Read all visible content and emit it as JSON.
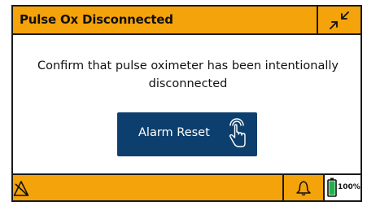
{
  "header": {
    "title": "Pulse Ox Disconnected"
  },
  "message": "Confirm that pulse oximeter has been intentionally disconnected",
  "alarm_button": {
    "label": "Alarm Reset"
  },
  "footer": {
    "battery_percent": "100%",
    "battery_level": 1.0
  },
  "colors": {
    "accent": "#f5a30a",
    "button": "#0d3f6e",
    "battery": "#22b14c"
  },
  "icons": [
    "collapse-arrows-icon",
    "hand-touch-icon",
    "warning-triangle-icon",
    "bell-icon",
    "battery-icon"
  ]
}
